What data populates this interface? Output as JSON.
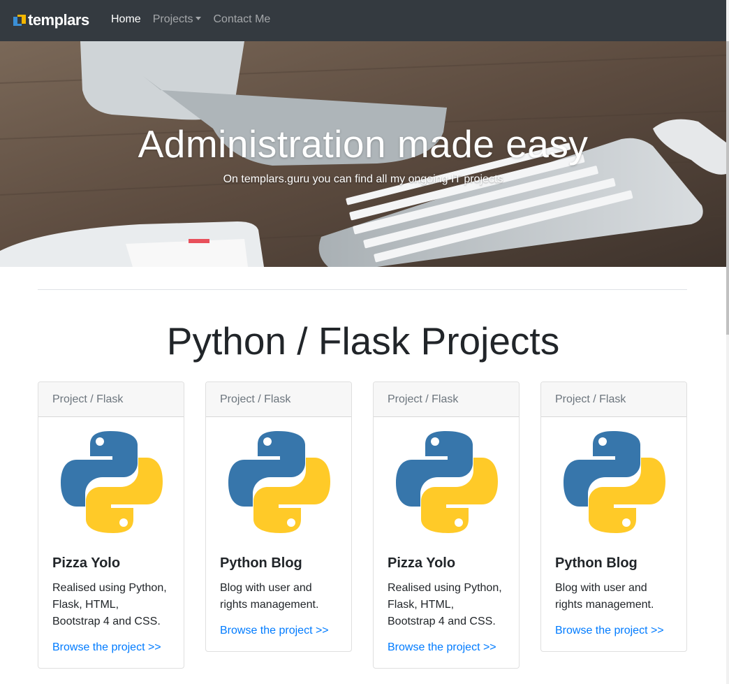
{
  "navbar": {
    "brand": "templars",
    "links": [
      {
        "label": "Home",
        "active": true
      },
      {
        "label": "Projects",
        "dropdown": true
      },
      {
        "label": "Contact Me"
      }
    ]
  },
  "hero": {
    "title": "Administration made easy",
    "subtitle": "On templars.guru you can find all my ongoing IT projects"
  },
  "main": {
    "section_title": "Python / Flask Projects",
    "cards": [
      {
        "header": "Project / Flask",
        "title": "Pizza Yolo",
        "text": "Realised using Python, Flask, HTML, Bootstrap 4 and CSS.",
        "link": "Browse the project >>",
        "icon": "python-logo-icon"
      },
      {
        "header": "Project / Flask",
        "title": "Python Blog",
        "text": "Blog with user and rights management.",
        "link": "Browse the project >>",
        "icon": "python-logo-icon"
      },
      {
        "header": "Project / Flask",
        "title": "Pizza Yolo",
        "text": "Realised using Python, Flask, HTML, Bootstrap 4 and CSS.",
        "link": "Browse the project >>",
        "icon": "python-logo-icon"
      },
      {
        "header": "Project / Flask",
        "title": "Python Blog",
        "text": "Blog with user and rights management.",
        "link": "Browse the project >>",
        "icon": "python-logo-icon"
      }
    ]
  },
  "colors": {
    "navbar_bg": "#343a40",
    "link": "#007bff",
    "python_blue": "#3776ab",
    "python_yellow": "#ffd43b"
  }
}
